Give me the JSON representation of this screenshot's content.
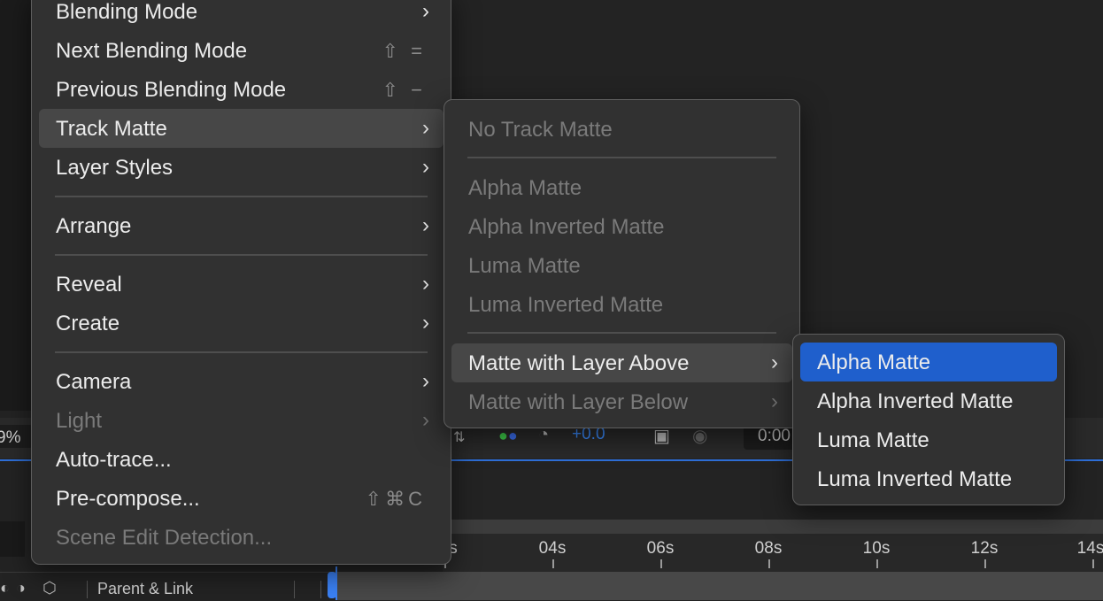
{
  "background": {
    "left_value": "9%",
    "delta_value": "+0.0",
    "timecode": "0:00",
    "parent_link_label": "Parent & Link",
    "ruler_ticks": [
      "s",
      "04s",
      "06s",
      "08s",
      "10s",
      "12s",
      "14s"
    ]
  },
  "main_menu": {
    "items": [
      {
        "label": "Blending Mode",
        "chevron": "›"
      },
      {
        "label": "Next Blending Mode",
        "shortcut": "⇧ ="
      },
      {
        "label": "Previous Blending Mode",
        "shortcut": "⇧ −"
      },
      {
        "label": "Track Matte",
        "chevron": "›"
      },
      {
        "label": "Layer Styles",
        "chevron": "›"
      },
      {
        "label": "Arrange",
        "chevron": "›"
      },
      {
        "label": "Reveal",
        "chevron": "›"
      },
      {
        "label": "Create",
        "chevron": "›"
      },
      {
        "label": "Camera",
        "chevron": "›"
      },
      {
        "label": "Light",
        "chevron": "›"
      },
      {
        "label": "Auto-trace..."
      },
      {
        "label": "Pre-compose...",
        "shortcut": "⇧⌘C"
      },
      {
        "label": "Scene Edit Detection..."
      }
    ]
  },
  "track_matte_menu": {
    "items": [
      {
        "label": "No Track Matte"
      },
      {
        "label": "Alpha Matte"
      },
      {
        "label": "Alpha Inverted Matte"
      },
      {
        "label": "Luma Matte"
      },
      {
        "label": "Luma Inverted Matte"
      },
      {
        "label": "Matte with Layer Above",
        "chevron": "›"
      },
      {
        "label": "Matte with Layer Below",
        "chevron": "›"
      }
    ]
  },
  "layer_above_menu": {
    "items": [
      {
        "label": "Alpha Matte"
      },
      {
        "label": "Alpha Inverted Matte"
      },
      {
        "label": "Luma Matte"
      },
      {
        "label": "Luma Inverted Matte"
      }
    ]
  },
  "colors": {
    "menu_bg": "#313131",
    "highlight": "#474747",
    "selected": "#1f5fcc",
    "accent_blue": "#2e6fd8"
  }
}
